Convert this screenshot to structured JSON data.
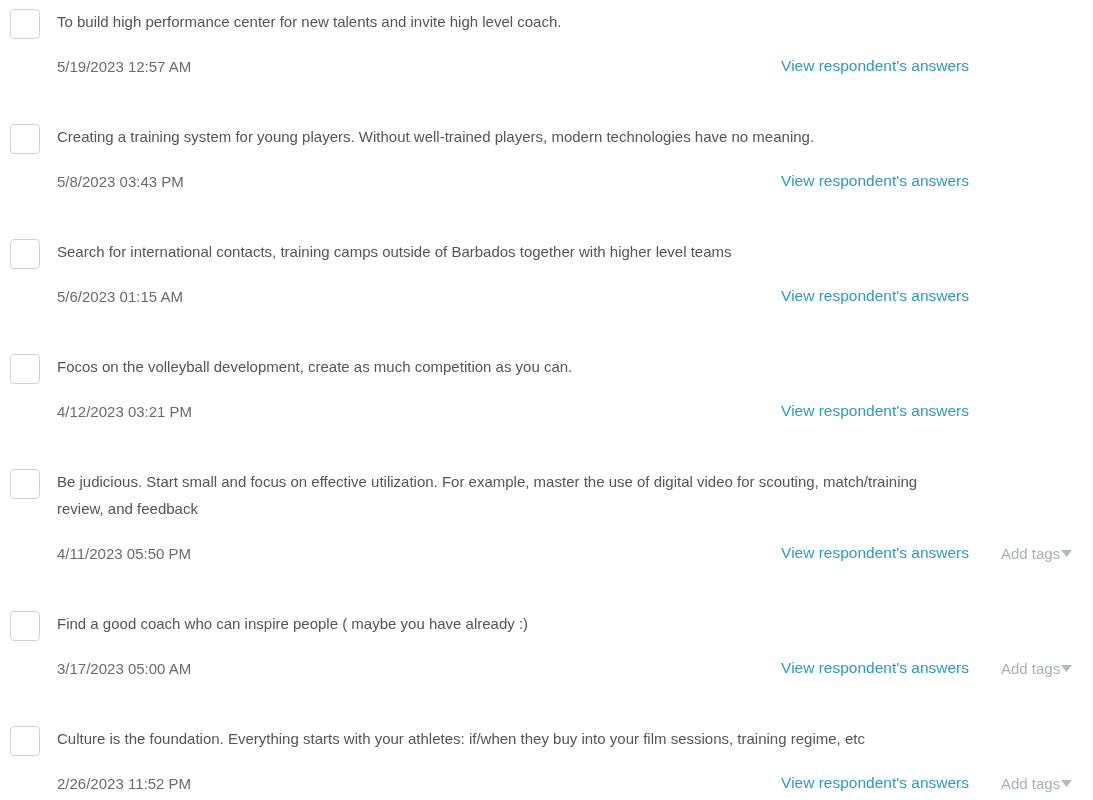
{
  "responses": [
    {
      "selected": false,
      "answer": "To build high performance center for new talents and invite high level coach.",
      "date": "5/19/2023 12:57 AM",
      "link": "View respondent's answers"
    },
    {
      "selected": false,
      "answer": "Creating a training system for young players. Without well-trained players, modern technologies have no meaning.",
      "date": "5/8/2023 03:43 PM",
      "link": "View respondent's answers"
    },
    {
      "selected": false,
      "answer": "Search for international contacts, training camps outside of Barbados together with higher level teams",
      "date": "5/6/2023 01:15 AM",
      "link": "View respondent's answers"
    },
    {
      "selected": false,
      "answer": "Focos on the volleyball development, create as much competition as you can.",
      "date": "4/12/2023 03:21 PM",
      "link": "View respondent's answers"
    },
    {
      "selected": false,
      "answer": "Be judicious. Start small and focus on effective utilization. For example, master the use of digital video for scouting, match/training review, and feedback",
      "date": "4/11/2023 05:50 PM",
      "link": "View respondent's answers",
      "tags": "Add tags"
    },
    {
      "selected": false,
      "answer": "Find a good coach who can inspire people ( maybe you have already :)",
      "date": "3/17/2023 05:00 AM",
      "link": "View respondent's answers",
      "tags": "Add tags"
    },
    {
      "selected": false,
      "answer": "Culture is the foundation. Everything starts with your athletes: if/when they buy into your film sessions, training regime, etc",
      "date": "2/26/2023 11:52 PM",
      "link": "View respondent's answers",
      "tags": "Add tags"
    }
  ]
}
